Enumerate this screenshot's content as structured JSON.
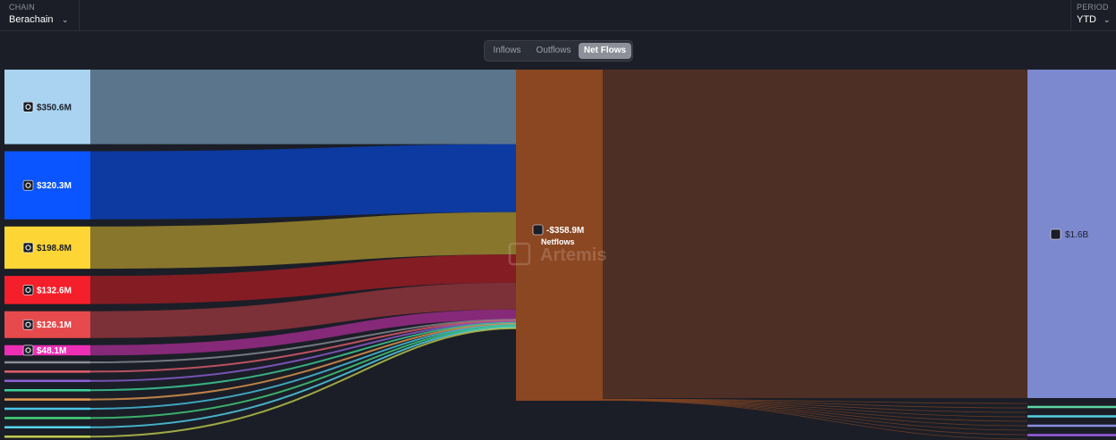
{
  "filters": {
    "chain_label": "CHAIN",
    "chain_value": "Berachain",
    "period_label": "PERIOD",
    "period_value": "YTD"
  },
  "view_tabs": [
    "Inflows",
    "Outflows",
    "Net Flows"
  ],
  "active_tab": "Net Flows",
  "watermark": "Artemis",
  "colors": {
    "background": "#1b1e27",
    "center_node": "#8a4722",
    "center_band": "#4e2f25",
    "right_node": "#7c89cf"
  },
  "chart_data": {
    "type": "sankey",
    "sources": [
      {
        "label": "$350.6M",
        "value": 350.6,
        "color": "#a9d3f0",
        "band": "#5f7a91",
        "text_color": "#1b1e27",
        "icon": "chain-logo-icon"
      },
      {
        "label": "$320.3M",
        "value": 320.3,
        "color": "#0a55ff",
        "band": "#0d3ca6",
        "text_color": "#ffffff",
        "icon": "chain-logo-icon"
      },
      {
        "label": "$198.8M",
        "value": 198.8,
        "color": "#fdd535",
        "band": "#8d7b2c",
        "text_color": "#1b1e27",
        "icon": "bnb-logo-icon"
      },
      {
        "label": "$132.6M",
        "value": 132.6,
        "color": "#f41f2a",
        "band": "#8a1c24",
        "text_color": "#ffffff",
        "icon": "chain-logo-icon"
      },
      {
        "label": "$126.1M",
        "value": 126.1,
        "color": "#e64a4c",
        "band": "#823238",
        "text_color": "#ffffff",
        "icon": "avalanche-logo-icon"
      },
      {
        "label": "$48.1M",
        "value": 48.1,
        "color": "#ec2fb5",
        "band": "#8c2a7c",
        "text_color": "#ffffff",
        "icon": "chain-logo-icon"
      }
    ],
    "minor_source_colors": [
      "#8a8d95",
      "#e35e6e",
      "#8f5fd7",
      "#3ed49a",
      "#e59a4f",
      "#49c6e6",
      "#43d47d",
      "#53d6f0",
      "#c1cc4b"
    ],
    "center": {
      "label": "-$358.9M",
      "sublabel": "Netflows",
      "value": -358.9
    },
    "destination": {
      "label": "$1.6B",
      "value": 1.6,
      "icon": "ethereum-logo-icon"
    },
    "minor_destination_colors": [
      "#5fd6a8",
      "#58d1e5",
      "#8a8fe0",
      "#9a5fe0"
    ]
  }
}
